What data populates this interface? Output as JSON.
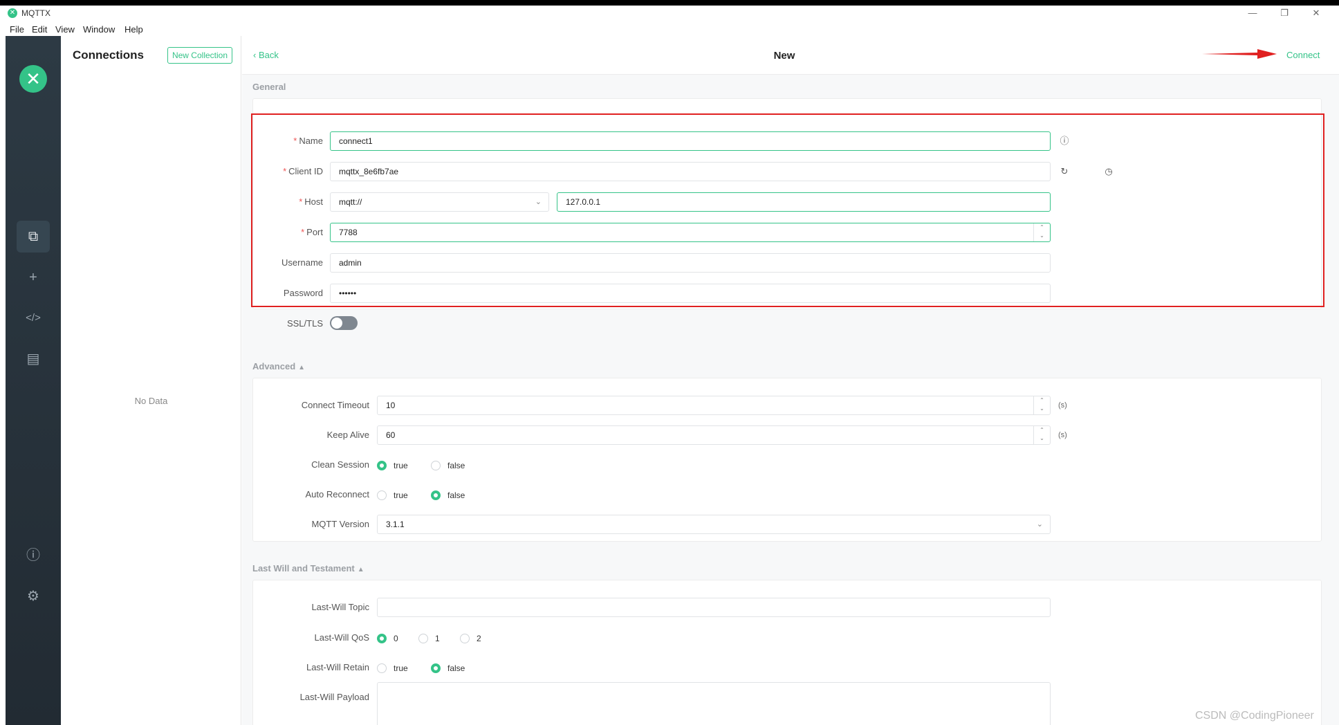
{
  "window": {
    "title": "MQTTX",
    "minimize": "—",
    "restore": "❐",
    "close": "✕"
  },
  "menu": [
    "File",
    "Edit",
    "View",
    "Window",
    "Help"
  ],
  "sidebar": {
    "logo": "✕",
    "icons": [
      "connections-icon",
      "plus-icon",
      "code-icon",
      "log-icon",
      "info-icon",
      "settings-icon"
    ]
  },
  "connections": {
    "title": "Connections",
    "new_collection": "New Collection",
    "empty": "No Data"
  },
  "header": {
    "back": "Back",
    "title": "New",
    "connect": "Connect"
  },
  "general": {
    "section": "General",
    "name": {
      "label": "Name",
      "value": "connect1"
    },
    "client_id": {
      "label": "Client ID",
      "value": "mqttx_8e6fb7ae"
    },
    "host": {
      "label": "Host",
      "protocol": "mqtt://",
      "value": "127.0.0.1"
    },
    "port": {
      "label": "Port",
      "value": "7788"
    },
    "username": {
      "label": "Username",
      "value": "admin"
    },
    "password": {
      "label": "Password",
      "value": "••••••"
    },
    "ssl": {
      "label": "SSL/TLS",
      "enabled": false
    }
  },
  "advanced": {
    "section": "Advanced",
    "connect_timeout": {
      "label": "Connect Timeout",
      "value": "10",
      "unit": "(s)"
    },
    "keep_alive": {
      "label": "Keep Alive",
      "value": "60",
      "unit": "(s)"
    },
    "clean_session": {
      "label": "Clean Session",
      "options": [
        "true",
        "false"
      ],
      "selected": "true"
    },
    "auto_reconnect": {
      "label": "Auto Reconnect",
      "options": [
        "true",
        "false"
      ],
      "selected": "false"
    },
    "mqtt_version": {
      "label": "MQTT Version",
      "value": "3.1.1"
    }
  },
  "last_will": {
    "section": "Last Will and Testament",
    "topic": {
      "label": "Last-Will Topic",
      "value": ""
    },
    "qos": {
      "label": "Last-Will QoS",
      "options": [
        "0",
        "1",
        "2"
      ],
      "selected": "0"
    },
    "retain": {
      "label": "Last-Will Retain",
      "options": [
        "true",
        "false"
      ],
      "selected": "false"
    },
    "payload": {
      "label": "Last-Will Payload",
      "value": ""
    }
  },
  "watermark": "CSDN @CodingPioneer",
  "colors": {
    "accent": "#34c388",
    "highlight": "#e02020",
    "sidebar": "#2d3a44"
  }
}
